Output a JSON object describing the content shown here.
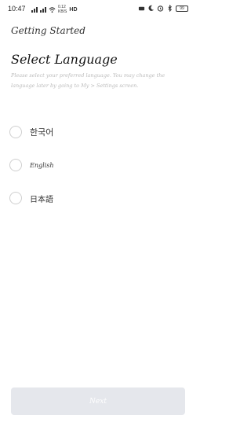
{
  "status_bar": {
    "time": "10:47",
    "speed_value": "0.12",
    "speed_unit": "KB/S",
    "network_label": "HD",
    "battery": "99"
  },
  "header": {
    "title": "Getting Started"
  },
  "page": {
    "title": "Select Language",
    "description": "Please select your preferred language. You may change the language later by going to My > Settings screen."
  },
  "languages": [
    {
      "label": "한국어",
      "selected": false
    },
    {
      "label": "English",
      "selected": false
    },
    {
      "label": "日本語",
      "selected": false
    }
  ],
  "footer": {
    "next_label": "Next"
  }
}
